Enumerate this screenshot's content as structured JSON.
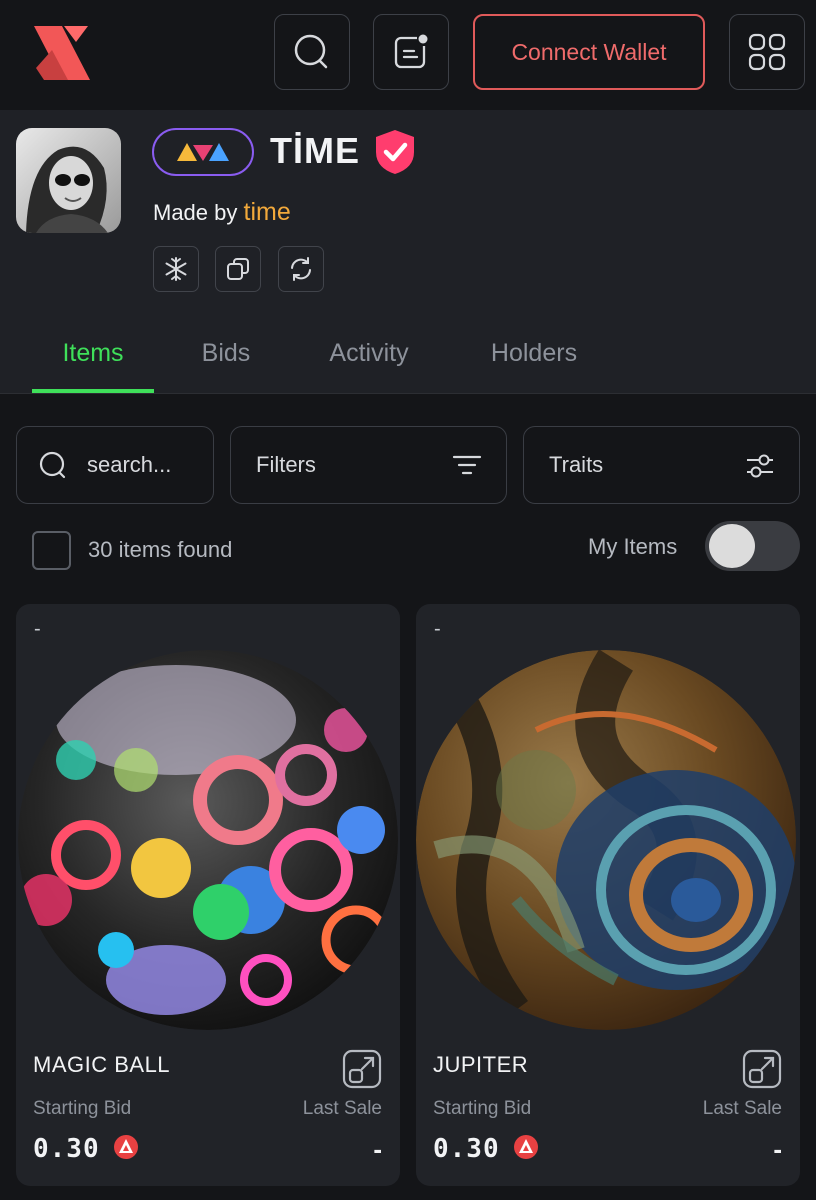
{
  "header": {
    "connect_label": "Connect Wallet",
    "icons": [
      "logo-icon",
      "search-icon",
      "notifications-icon",
      "grid-menu-icon"
    ]
  },
  "collection": {
    "name": "TİME",
    "made_by_label": "Made by",
    "creator": "time",
    "verified": true,
    "action_icons": [
      "snowflake-icon",
      "copy-icon",
      "refresh-icon"
    ],
    "tabs": [
      {
        "label": "Items",
        "active": true
      },
      {
        "label": "Bids",
        "active": false
      },
      {
        "label": "Activity",
        "active": false
      },
      {
        "label": "Holders",
        "active": false
      }
    ]
  },
  "filters": {
    "search_placeholder": "search...",
    "filters_label": "Filters",
    "traits_label": "Traits",
    "items_found": "30 items found",
    "my_items_label": "My Items",
    "my_items_on": false
  },
  "cards": [
    {
      "top_label": "-",
      "name": "MAGIC BALL",
      "starting_bid_label": "Starting Bid",
      "last_sale_label": "Last Sale",
      "price": "0.30",
      "last_sale": "-"
    },
    {
      "top_label": "-",
      "name": "JUPITER",
      "starting_bid_label": "Starting Bid",
      "last_sale_label": "Last Sale",
      "price": "0.30",
      "last_sale": "-"
    }
  ],
  "colors": {
    "accent_green": "#3fe05a",
    "connect_red": "#ef6b6b",
    "creator_orange": "#f2a93b",
    "verified_pink": "#ff3d6e",
    "avax_red": "#e84142"
  }
}
